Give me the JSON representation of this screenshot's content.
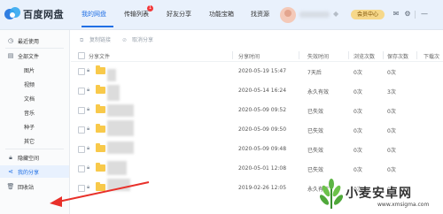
{
  "app": {
    "name": "百度网盘"
  },
  "nav": {
    "tabs": [
      {
        "label": "我的网盘",
        "active": true
      },
      {
        "label": "传输列表",
        "active": false
      },
      {
        "label": "好友分享",
        "active": false
      },
      {
        "label": "功能宝箱",
        "active": false
      },
      {
        "label": "找资源",
        "active": false
      }
    ],
    "badge": "1"
  },
  "header": {
    "member_label": "会员中心",
    "icons": [
      "mail-icon",
      "gear-icon",
      "minus-icon"
    ]
  },
  "sidebar": {
    "items": [
      {
        "icon": "clock-icon",
        "label": "最近使用"
      },
      {
        "icon": "file-icon",
        "label": "全部文件"
      },
      {
        "icon": "",
        "label": "图片"
      },
      {
        "icon": "",
        "label": "视频"
      },
      {
        "icon": "",
        "label": "文档"
      },
      {
        "icon": "",
        "label": "音乐"
      },
      {
        "icon": "",
        "label": "种子"
      },
      {
        "icon": "",
        "label": "其它"
      },
      {
        "icon": "lock-icon",
        "label": "隐藏空间"
      },
      {
        "icon": "share-icon",
        "label": "我的分享",
        "active": true
      },
      {
        "icon": "trash-icon",
        "label": "回收站"
      }
    ]
  },
  "toolbar": {
    "copy_link": "复制链接",
    "cancel_share": "取消分享"
  },
  "table": {
    "headers": [
      "分享文件",
      "分享时间",
      "失效时间",
      "浏览次数",
      "保存次数",
      "下载次"
    ],
    "rows": [
      {
        "time": "2020-05-19 15:47",
        "expire": "7天后",
        "views": "0次",
        "saves": "0次"
      },
      {
        "time": "2020-05-14 16:24",
        "expire": "永久有效",
        "views": "0次",
        "saves": "3次"
      },
      {
        "time": "2020-05-09 09:52",
        "expire": "已失效",
        "views": "0次",
        "saves": "0次"
      },
      {
        "time": "2020-05-09 09:50",
        "expire": "已失效",
        "views": "0次",
        "saves": "0次"
      },
      {
        "time": "2020-05-09 09:48",
        "expire": "已失效",
        "views": "0次",
        "saves": "0次"
      },
      {
        "time": "2020-05-01 12:08",
        "expire": "已失效",
        "views": "0次",
        "saves": "0次"
      },
      {
        "time": "2019-02-26 12:05",
        "expire": "永久有效",
        "views": "0次",
        "saves": "0次"
      }
    ]
  },
  "watermark": {
    "text": "小麦安卓网",
    "url": "www.xmsigma.com"
  },
  "colors": {
    "accent": "#1f6fe5",
    "folder": "#f8c94a",
    "badge": "#f2383a",
    "member": "#f6d88a",
    "arrow": "#e8302a"
  }
}
